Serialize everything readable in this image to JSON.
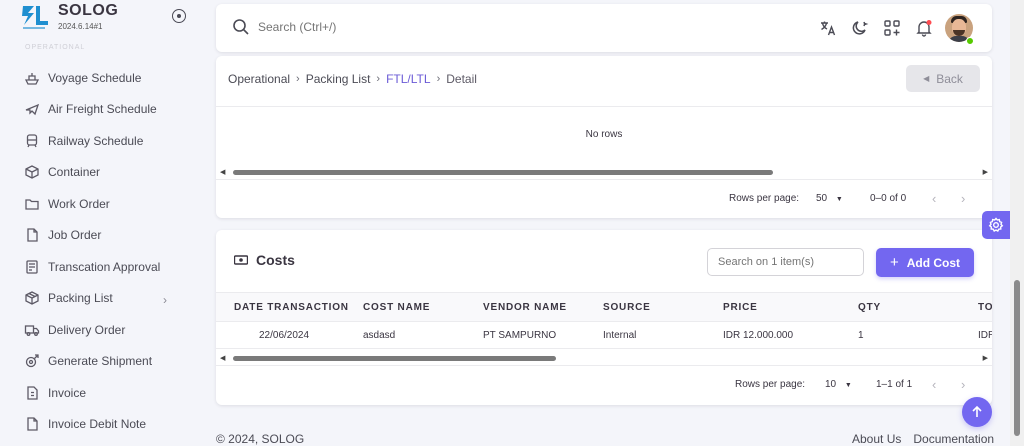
{
  "brand": {
    "name": "SOLOG",
    "version": "2024.6.14#1",
    "logo_color": "#1f8fd0"
  },
  "sidebar": {
    "section_label": "OPERATIONAL",
    "items": [
      {
        "label": "Voyage Schedule",
        "icon": "ship-icon"
      },
      {
        "label": "Air Freight Schedule",
        "icon": "plane-icon"
      },
      {
        "label": "Railway Schedule",
        "icon": "train-icon"
      },
      {
        "label": "Container",
        "icon": "box-icon"
      },
      {
        "label": "Work Order",
        "icon": "folder-icon"
      },
      {
        "label": "Job Order",
        "icon": "file-icon"
      },
      {
        "label": "Transcation Approval",
        "icon": "receipt-icon"
      },
      {
        "label": "Packing List",
        "icon": "package-icon",
        "has_children": true
      },
      {
        "label": "Delivery Order",
        "icon": "truck-icon"
      },
      {
        "label": "Generate Shipment",
        "icon": "shipment-icon"
      },
      {
        "label": "Invoice",
        "icon": "invoice-icon"
      },
      {
        "label": "Invoice Debit Note",
        "icon": "document-icon"
      }
    ]
  },
  "header": {
    "search_placeholder": "Search (Ctrl+/)",
    "icons": [
      "translate-icon",
      "theme-toggle-icon",
      "apps-icon",
      "notification-bell-icon",
      "avatar"
    ]
  },
  "breadcrumb": {
    "items": [
      "Operational",
      "Packing List",
      "FTL/LTL",
      "Detail"
    ],
    "separator": "›",
    "back_label": "Back"
  },
  "packing_table": {
    "empty_text": "No rows",
    "rows_per_page_label": "Rows per page:",
    "rows_per_page": "50",
    "range": "0–0 of 0"
  },
  "costs": {
    "title": "Costs",
    "search_placeholder": "Search on 1 item(s)",
    "add_label": "Add Cost",
    "columns": [
      "DATE TRANSACTION",
      "COST NAME",
      "VENDOR NAME",
      "SOURCE",
      "PRICE",
      "QTY",
      "TO"
    ],
    "rows": [
      [
        "22/06/2024",
        "asdasd",
        "PT SAMPURNO",
        "Internal",
        "IDR 12.000.000",
        "1",
        "IDR"
      ]
    ],
    "rows_per_page_label": "Rows per page:",
    "rows_per_page": "10",
    "range": "1–1 of 1"
  },
  "footer": {
    "copyright": "© 2024, SOLOG",
    "links": [
      "About Us",
      "Documentation"
    ]
  },
  "colors": {
    "primary": "#7367f0",
    "link": "#6b5bd6",
    "online": "#56ca00",
    "notification_dot": "#ff4c51"
  }
}
